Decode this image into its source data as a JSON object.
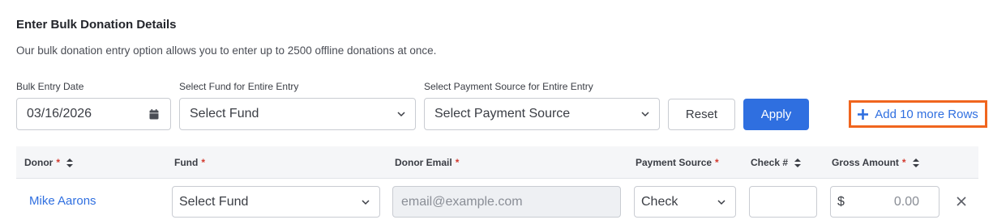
{
  "header": {
    "title": "Enter Bulk Donation Details",
    "subtitle": "Our bulk donation entry option allows you to enter up to 2500 offline donations at once."
  },
  "bulk_controls": {
    "date_label": "Bulk Entry Date",
    "date_value": "03/16/2026",
    "fund_label": "Select Fund for Entire Entry",
    "fund_value": "Select Fund",
    "payment_label": "Select Payment Source for Entire Entry",
    "payment_value": "Select Payment Source",
    "reset_label": "Reset",
    "apply_label": "Apply",
    "add_rows_label": "Add 10 more Rows"
  },
  "table": {
    "columns": [
      {
        "label": "Donor",
        "required": "*"
      },
      {
        "label": "Fund",
        "required": "*"
      },
      {
        "label": "Donor Email",
        "required": "*"
      },
      {
        "label": "Payment Source",
        "required": "*"
      },
      {
        "label": "Check #",
        "required": ""
      },
      {
        "label": "Gross Amount",
        "required": "*"
      }
    ],
    "rows": [
      {
        "donor": "Mike Aarons",
        "fund": "Select Fund",
        "email_placeholder": "email@example.com",
        "payment_source": "Check",
        "check_number": "",
        "currency": "$",
        "amount_placeholder": "0.00"
      }
    ]
  },
  "colors": {
    "primary": "#2f6fe0",
    "highlight_border": "#f0651e",
    "required": "#d33a2f"
  },
  "icons": {
    "calendar": "calendar-icon",
    "chevron": "chevron-down-icon",
    "sort": "sort-icon",
    "plus": "plus-icon",
    "remove": "close-icon"
  }
}
